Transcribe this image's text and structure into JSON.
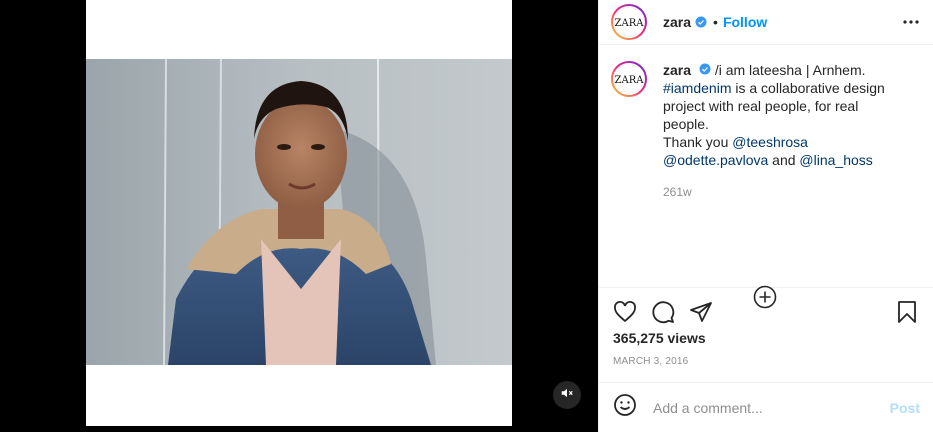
{
  "post": {
    "author": "zara",
    "follow_label": "Follow",
    "dot": "•",
    "logo_text": "ZARA"
  },
  "caption": {
    "username": "zara",
    "line1": "/i am lateesha | Arnhem.",
    "hashtag": "#iamdenim",
    "line2": " is a collaborative design project with real people, for real people.",
    "thanks": "Thank you ",
    "mention1": "@teeshrosa",
    "mention2": "@odette.pavlova",
    "and": " and ",
    "mention3": "@lina_hoss",
    "timestamp": "261w"
  },
  "stats": {
    "views": "365,275 views",
    "date": "MARCH 3, 2016"
  },
  "comment": {
    "placeholder": "Add a comment...",
    "post_label": "Post"
  },
  "icons": {
    "verified": "verified-badge-icon",
    "more": "more-options-icon",
    "heart": "like-icon",
    "comment": "comment-icon",
    "share": "share-icon",
    "save": "bookmark-icon",
    "emoji": "emoji-icon",
    "mute": "muted-speaker-icon",
    "load_more": "plus-circle-icon"
  },
  "colors": {
    "accent": "#0095f6",
    "link": "#00376b",
    "muted": "#8e8e8e",
    "post_disabled": "#b2dffc"
  }
}
